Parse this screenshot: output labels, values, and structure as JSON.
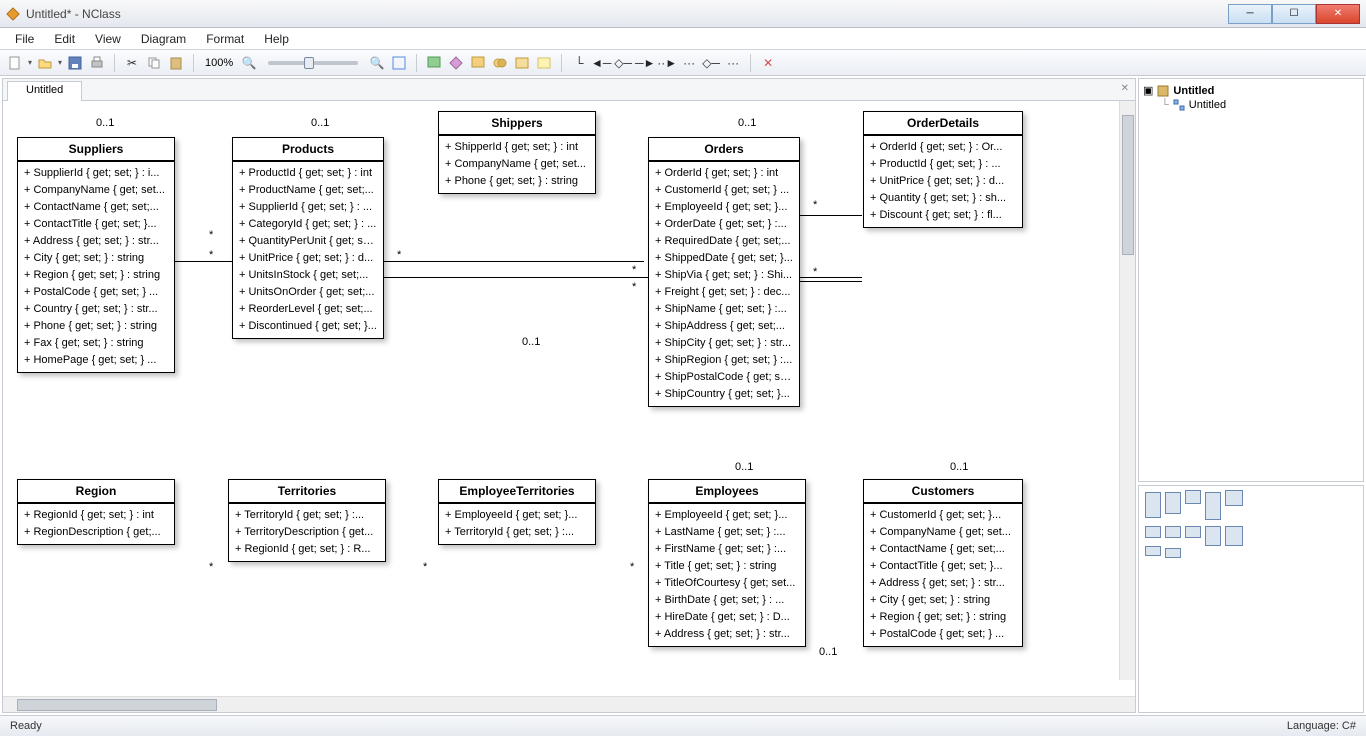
{
  "window": {
    "title": "Untitled* - NClass"
  },
  "menu": [
    "File",
    "Edit",
    "View",
    "Diagram",
    "Format",
    "Help"
  ],
  "zoom": "100%",
  "tab": "Untitled",
  "tree": {
    "root": "Untitled",
    "child": "Untitled"
  },
  "status": {
    "left": "Ready",
    "right": "Language: C#"
  },
  "mults": {
    "suppliers_top": "0..1",
    "products_top": "0..1",
    "orders_top": "0..1",
    "shippers_bottom": "0..1",
    "orders_bottom": "0..1",
    "orderdetails_bottom": "0..1",
    "employees_right": "0..1",
    "star": "*"
  },
  "classes": {
    "suppliers": {
      "name": "Suppliers",
      "members": [
        "+ SupplierId { get; set; } : i...",
        "+ CompanyName { get; set...",
        "+ ContactName { get; set;...",
        "+ ContactTitle { get; set; }...",
        "+ Address { get; set; } : str...",
        "+ City { get; set; } : string",
        "+ Region { get; set; } : string",
        "+ PostalCode { get; set; } ...",
        "+ Country { get; set; } : str...",
        "+ Phone { get; set; } : string",
        "+ Fax { get; set; } : string",
        "+ HomePage { get; set; } ..."
      ]
    },
    "products": {
      "name": "Products",
      "members": [
        "+ ProductId { get; set; } : int",
        "+ ProductName { get; set;...",
        "+ SupplierId { get; set; } : ...",
        "+ CategoryId { get; set; } : ...",
        "+ QuantityPerUnit { get; se...",
        "+ UnitPrice { get; set; } : d...",
        "+ UnitsInStock { get; set;...",
        "+ UnitsOnOrder { get; set;...",
        "+ ReorderLevel { get; set;...",
        "+ Discontinued { get; set; }..."
      ]
    },
    "shippers": {
      "name": "Shippers",
      "members": [
        "+ ShipperId { get; set; } : int",
        "+ CompanyName { get; set...",
        "+ Phone { get; set; } : string"
      ]
    },
    "orders": {
      "name": "Orders",
      "members": [
        "+ OrderId { get; set; } : int",
        "+ CustomerId { get; set; } ...",
        "+ EmployeeId { get; set; }...",
        "+ OrderDate { get; set; } :...",
        "+ RequiredDate { get; set;...",
        "+ ShippedDate { get; set; }...",
        "+ ShipVia { get; set; } : Shi...",
        "+ Freight { get; set; } : dec...",
        "+ ShipName { get; set; } :...",
        "+ ShipAddress { get; set;...",
        "+ ShipCity { get; set; } : str...",
        "+ ShipRegion { get; set; } :...",
        "+ ShipPostalCode { get; set...",
        "+ ShipCountry { get; set; }..."
      ]
    },
    "orderdetails": {
      "name": "OrderDetails",
      "members": [
        "+ OrderId { get; set; } : Or...",
        "+ ProductId { get; set; } : ...",
        "+ UnitPrice { get; set; } : d...",
        "+ Quantity { get; set; } : sh...",
        "+ Discount { get; set; } : fl..."
      ]
    },
    "region": {
      "name": "Region",
      "members": [
        "+ RegionId { get; set; } : int",
        "+ RegionDescription { get;..."
      ]
    },
    "territories": {
      "name": "Territories",
      "members": [
        "+ TerritoryId { get; set; } :...",
        "+ TerritoryDescription { get...",
        "+ RegionId { get; set; } : R..."
      ]
    },
    "employeeterr": {
      "name": "EmployeeTerritories",
      "members": [
        "+ EmployeeId { get; set; }...",
        "+ TerritoryId { get; set; } :..."
      ]
    },
    "employees": {
      "name": "Employees",
      "members": [
        "+ EmployeeId { get; set; }...",
        "+ LastName { get; set; } :...",
        "+ FirstName { get; set; } :...",
        "+ Title { get; set; } : string",
        "+ TitleOfCourtesy { get; set...",
        "+ BirthDate { get; set; } : ...",
        "+ HireDate { get; set; } : D...",
        "+ Address { get; set; } : str..."
      ]
    },
    "customers": {
      "name": "Customers",
      "members": [
        "+ CustomerId { get; set; }...",
        "+ CompanyName { get; set...",
        "+ ContactName { get; set;...",
        "+ ContactTitle { get; set; }...",
        "+ Address { get; set; } : str...",
        "+ City { get; set; } : string",
        "+ Region { get; set; } : string",
        "+ PostalCode { get; set; } ..."
      ]
    }
  }
}
